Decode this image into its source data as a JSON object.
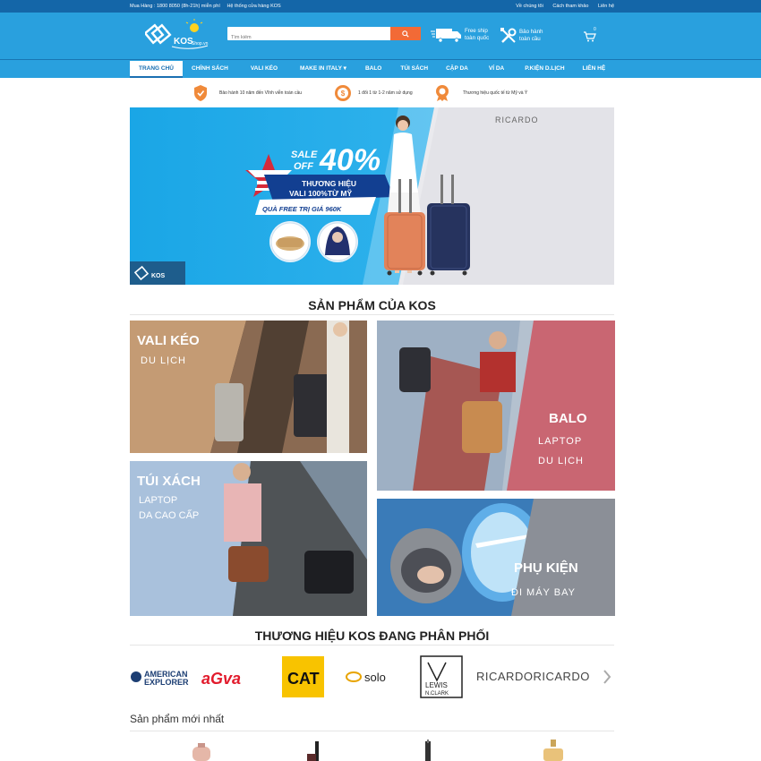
{
  "topbar": {
    "hotline": "Mua Hàng : 1800 8050 (8h-21h) miễn phí",
    "stores": "Hệ thống cửa hàng KOS",
    "about": "Về chúng tôi",
    "reference": "Cách tham khảo",
    "contact": "Liên hệ"
  },
  "header": {
    "logo_text": "KOS",
    "logo_sub": "Shop.vn",
    "search_placeholder": "Tìm kiếm",
    "ship_line1": "Free ship",
    "ship_line2": "toàn quốc",
    "warranty_line1": "Bảo hành",
    "warranty_line2": "toàn cầu",
    "cart_count": "0"
  },
  "nav": {
    "items": [
      {
        "label": "TRANG CHỦ"
      },
      {
        "label": "CHÍNH SÁCH"
      },
      {
        "label": "VALI KÉO"
      },
      {
        "label": "MAKE IN ITALY ▾"
      },
      {
        "label": "BALO"
      },
      {
        "label": "TÚI SÁCH"
      },
      {
        "label": "CẶP DA"
      },
      {
        "label": "VÍ DA"
      },
      {
        "label": "P.KIỆN D.LỊCH"
      },
      {
        "label": "LIÊN HỆ"
      }
    ]
  },
  "policy": {
    "p1": "Bảo hành 10 năm đến Vĩnh viễn toàn cầu",
    "p2": "1 đổi 1 từ 1-2 năm sử dụng",
    "p3": "Thương hiệu quốc tế từ Mỹ và Ý"
  },
  "banner": {
    "sale": "SALE",
    "off": "OFF",
    "percent": "40%",
    "line1": "THƯƠNG HIỆU",
    "line2": "VALI 100%TỪ MỸ",
    "gift": "QUÀ FREE TRỊ GIÁ 960K",
    "brand": "RICARDO",
    "logo": "KOS"
  },
  "section1": {
    "title": "SẢN PHẨM CỦA KOS"
  },
  "categories": {
    "vali": {
      "title": "VALI KÉO",
      "sub": "DU LỊCH"
    },
    "balo": {
      "title": "BALO",
      "sub1": "LAPTOP",
      "sub2": "DU LỊCH"
    },
    "tui": {
      "title": "TÚI XÁCH",
      "sub1": "LAPTOP",
      "sub2": "DA CAO CẤP"
    },
    "phukien": {
      "title": "PHỤ KIỆN",
      "sub": "ĐI MÁY BAY"
    }
  },
  "section2": {
    "title": "THƯƠNG HIỆU KOS ĐANG PHÂN PHỐI"
  },
  "brands": {
    "b1a": "AMERICAN",
    "b1b": "EXPLORER",
    "b2": "aGva",
    "b3": "CAT",
    "b4": "solo",
    "b5a": "LEWIS",
    "b5b": "N.CLARK",
    "b6": "RICARDORICARDO"
  },
  "section3": {
    "title": "Sản phẩm mới nhất"
  },
  "colors": {
    "primary": "#29a0de",
    "dark": "#1466a8",
    "accent": "#f26a36"
  }
}
